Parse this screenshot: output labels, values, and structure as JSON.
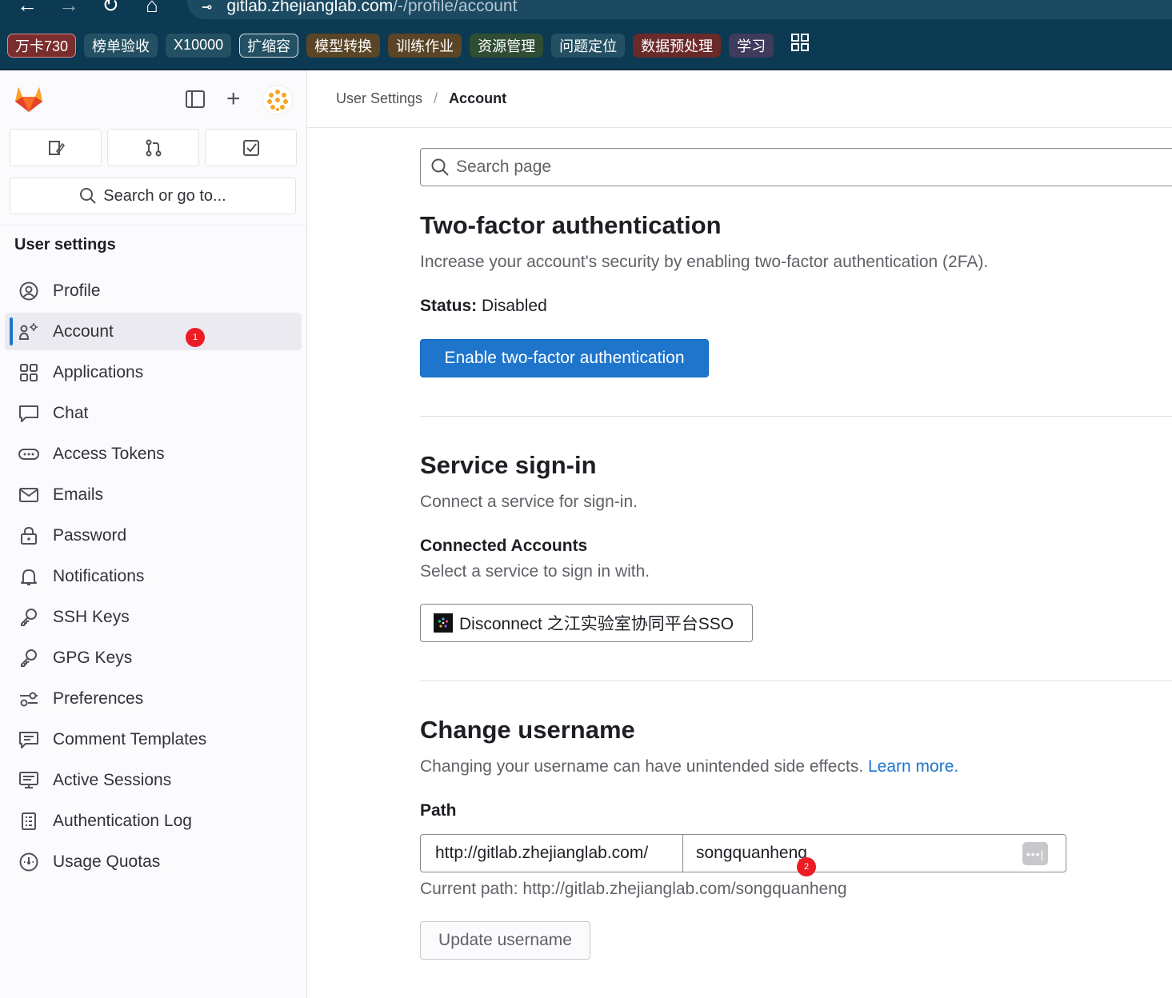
{
  "browser": {
    "url_host": "gitlab.zhejianglab.com",
    "url_path": "/-/profile/account"
  },
  "bookmarks": [
    "万卡730",
    "榜单验收",
    "X10000",
    "扩缩容",
    "模型转换",
    "训练作业",
    "资源管理",
    "问题定位",
    "数据预处理",
    "学习"
  ],
  "sidebar": {
    "search_label": "Search or go to...",
    "section_title": "User settings",
    "items": [
      {
        "label": "Profile",
        "icon": "profile-icon"
      },
      {
        "label": "Account",
        "icon": "account-icon",
        "active": true
      },
      {
        "label": "Applications",
        "icon": "applications-icon"
      },
      {
        "label": "Chat",
        "icon": "chat-icon"
      },
      {
        "label": "Access Tokens",
        "icon": "token-icon"
      },
      {
        "label": "Emails",
        "icon": "mail-icon"
      },
      {
        "label": "Password",
        "icon": "lock-icon"
      },
      {
        "label": "Notifications",
        "icon": "bell-icon"
      },
      {
        "label": "SSH Keys",
        "icon": "key-icon"
      },
      {
        "label": "GPG Keys",
        "icon": "key-icon"
      },
      {
        "label": "Preferences",
        "icon": "preferences-icon"
      },
      {
        "label": "Comment Templates",
        "icon": "comment-icon"
      },
      {
        "label": "Active Sessions",
        "icon": "monitor-icon"
      },
      {
        "label": "Authentication Log",
        "icon": "log-icon"
      },
      {
        "label": "Usage Quotas",
        "icon": "quota-icon"
      }
    ]
  },
  "markers": {
    "one": "1",
    "two": "2"
  },
  "breadcrumb": {
    "parent": "User Settings",
    "current": "Account"
  },
  "search": {
    "placeholder": "Search page"
  },
  "two_factor": {
    "title": "Two-factor authentication",
    "description": "Increase your account's security by enabling two-factor authentication (2FA).",
    "status_label": "Status:",
    "status_value": "Disabled",
    "enable_button": "Enable two-factor authentication"
  },
  "service_signin": {
    "title": "Service sign-in",
    "description": "Connect a service for sign-in.",
    "connected_title": "Connected Accounts",
    "connected_desc": "Select a service to sign in with.",
    "disconnect_button": "Disconnect 之江实验室协同平台SSO"
  },
  "change_username": {
    "title": "Change username",
    "description": "Changing your username can have unintended side effects.",
    "learn_more": "Learn more.",
    "path_label": "Path",
    "path_prefix": "http://gitlab.zhejianglab.com/",
    "username_value": "songquanheng",
    "current_path": "Current path: http://gitlab.zhejianglab.com/songquanheng",
    "update_button": "Update username"
  },
  "colors": {
    "primary": "#1f75cb",
    "badge": "#ec1c24",
    "browser_bg": "#0c3a52"
  }
}
